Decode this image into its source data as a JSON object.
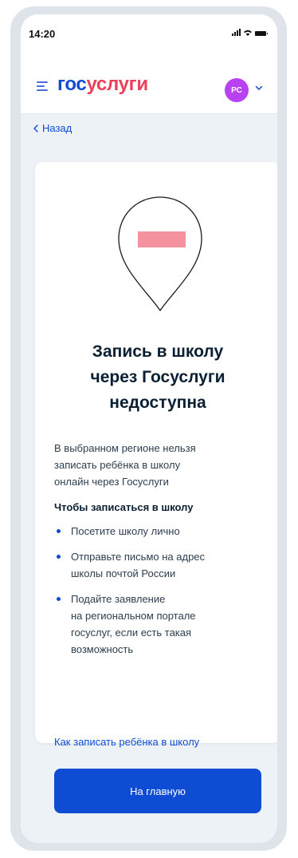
{
  "status_bar": {
    "time": "14:20"
  },
  "header": {
    "logo_part1": "гос",
    "logo_part2": "услуги",
    "avatar_initials": "РС"
  },
  "nav": {
    "back_label": "Назад"
  },
  "card": {
    "title_line1": "Запись в школу",
    "title_line2": "через Госуслуги",
    "title_line3": "недоступна",
    "description_lines": [
      "В выбранном регионе нельзя",
      "записать ребёнка в школу",
      "онлайн через Госуслуги"
    ],
    "subheading": "Чтобы записаться в школу",
    "bullets": [
      [
        "Посетите школу лично"
      ],
      [
        "Отправьте письмо на адрес",
        "школы почтой России"
      ],
      [
        "Подайте заявление",
        "на региональном портале",
        "госуслуг, если есть такая",
        "возможность"
      ]
    ],
    "help_link": "Как записать ребёнка в школу",
    "primary_button": "На главную"
  },
  "colors": {
    "brand_blue": "#0d4cd3",
    "brand_red": "#ee3f58",
    "avatar": "#b842f2",
    "background": "#edf2f7"
  }
}
